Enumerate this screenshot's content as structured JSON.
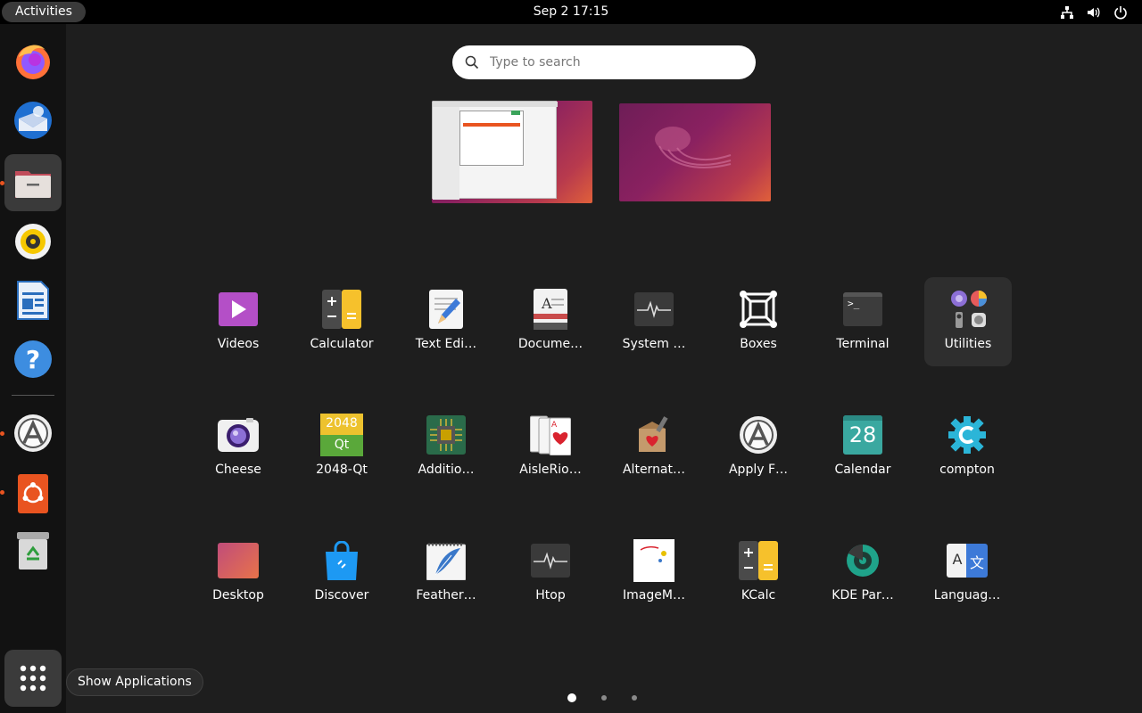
{
  "topbar": {
    "activities": "Activities",
    "clock": "Sep 2  17:15"
  },
  "search": {
    "placeholder": "Type to search"
  },
  "dock": {
    "tooltip": "Show Applications",
    "items": [
      "firefox",
      "thunderbird",
      "files",
      "rhythmbox",
      "libreoffice-writer",
      "help",
      "software-updater",
      "ubuntu-software",
      "trash"
    ]
  },
  "apps": {
    "videos": "Videos",
    "calculator": "Calculator",
    "text_editor": "Text Edi…",
    "document_viewer": "Docume…",
    "system_monitor": "System …",
    "boxes": "Boxes",
    "terminal": "Terminal",
    "utilities": "Utilities",
    "cheese": "Cheese",
    "qt2048": "2048-Qt",
    "additional_drivers": "Additio…",
    "aisleriot": "AisleRio…",
    "alternatives": "Alternat…",
    "apply_fixes": "Apply F…",
    "calendar": "Calendar",
    "compton": "compton",
    "desktop": "Desktop",
    "discover": "Discover",
    "feather": "Feather…",
    "htop": "Htop",
    "imagemagick": "ImageM…",
    "kcalc": "KCalc",
    "kde_partition": "KDE Par…",
    "language": "Languag…"
  },
  "icon_text": {
    "calendar_day": "28",
    "qt_top": "2048",
    "qt_bottom": "Qt",
    "terminal_prompt": ">_",
    "language_a": "A",
    "language_b": "文"
  },
  "pages": {
    "total": 3,
    "current": 1
  },
  "colors": {
    "accent": "#e95420",
    "panel": "#000000",
    "dock": "#121212",
    "background": "#1e1e1e"
  }
}
